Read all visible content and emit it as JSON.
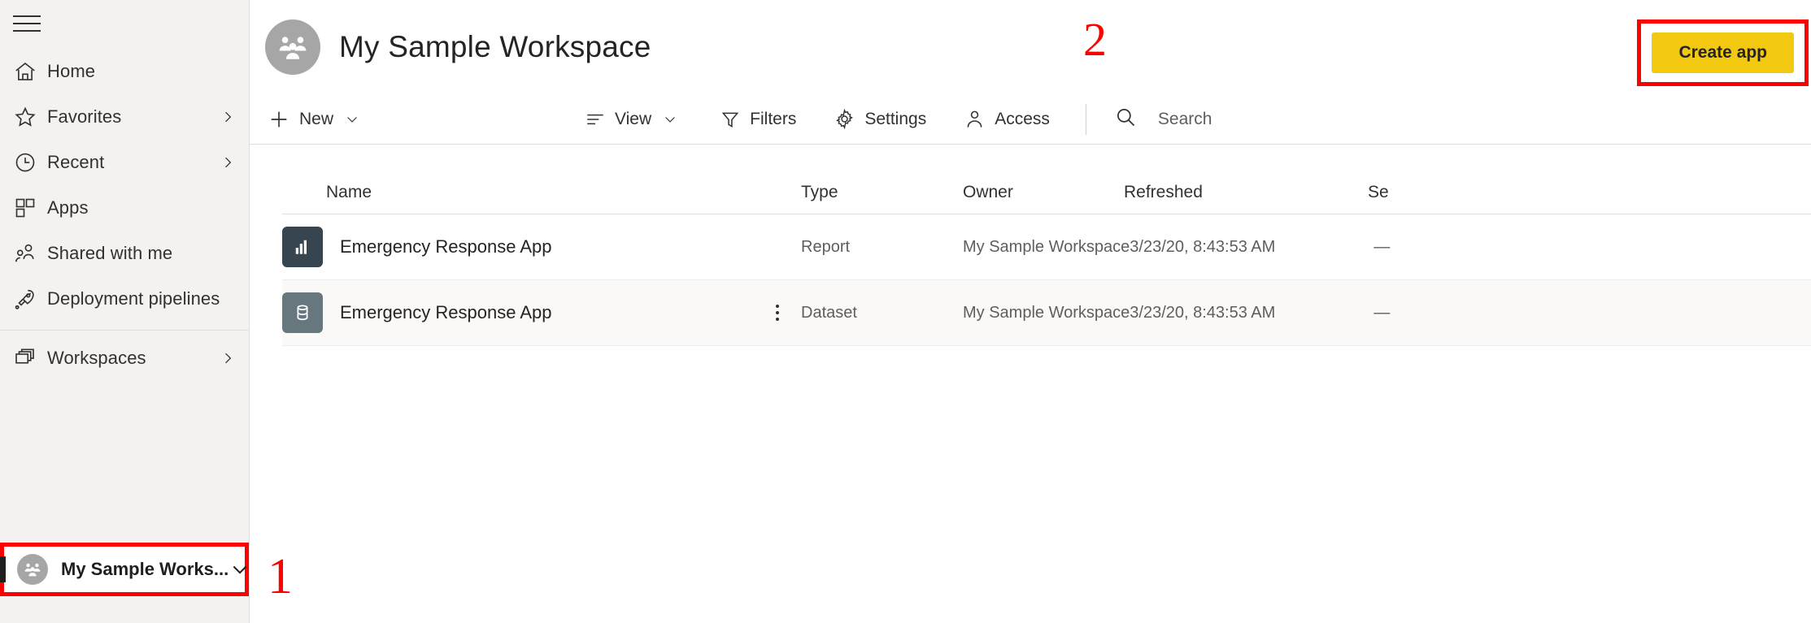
{
  "sidebar": {
    "hamburger_label": "Menu",
    "items": [
      {
        "label": "Home",
        "icon": "home-icon",
        "chevron": ""
      },
      {
        "label": "Favorites",
        "icon": "star-icon",
        "chevron": "›"
      },
      {
        "label": "Recent",
        "icon": "clock-icon",
        "chevron": "›"
      },
      {
        "label": "Apps",
        "icon": "apps-grid-icon",
        "chevron": ""
      },
      {
        "label": "Shared with me",
        "icon": "people-icon",
        "chevron": ""
      },
      {
        "label": "Deployment pipelines",
        "icon": "rocket-icon",
        "chevron": ""
      }
    ],
    "workspaces": {
      "label": "Workspaces",
      "icon": "workspaces-stack-icon",
      "chevron": "›"
    },
    "selected_workspace": {
      "label": "My Sample Works...",
      "icon": "workspace-group-avatar",
      "caret": "chevron-down-icon",
      "highlight_color": "#ff0000"
    }
  },
  "header": {
    "title": "My Sample Workspace",
    "avatar_icon": "workspace-group-avatar",
    "create_app_label": "Create app",
    "create_app_color": "#f2c811"
  },
  "annotations": {
    "one": "1",
    "two": "2",
    "color": "#ff0000"
  },
  "toolbar": {
    "new_label": "New",
    "view_label": "View",
    "filters_label": "Filters",
    "settings_label": "Settings",
    "access_label": "Access",
    "search_placeholder": "Search"
  },
  "table": {
    "columns": [
      "Name",
      "Type",
      "Owner",
      "Refreshed",
      "Se"
    ],
    "rows": [
      {
        "name": "Emergency Response App",
        "icon": "report-bar-chart-icon",
        "icon_color": "#36454f",
        "type": "Report",
        "owner": "My Sample Workspace",
        "refreshed": "3/23/20, 8:43:53 AM",
        "sensitivity": "—",
        "kebab": ""
      },
      {
        "name": "Emergency Response App",
        "icon": "dataset-database-icon",
        "icon_color": "#66777d",
        "type": "Dataset",
        "owner": "My Sample Workspace",
        "refreshed": "3/23/20, 8:43:53 AM",
        "sensitivity": "—",
        "kebab": "more-options-icon"
      }
    ]
  }
}
